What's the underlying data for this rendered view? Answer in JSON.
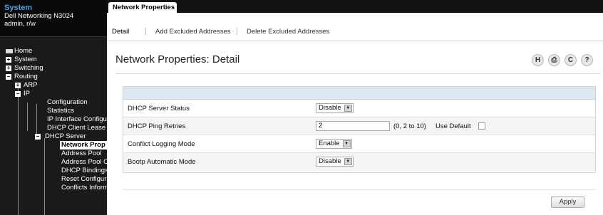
{
  "sidebar": {
    "title": "System",
    "device": "Dell Networking N3024",
    "user": "admin, r/w",
    "tree": {
      "home": "Home",
      "system": "System",
      "switching": "Switching",
      "routing": "Routing",
      "arp": "ARP",
      "ip": "IP",
      "configuration": "Configuration",
      "statistics": "Statistics",
      "ip_interface": "IP Interface Configu",
      "dhcp_client": "DHCP Client Lease",
      "dhcp_server": "DHCP Server",
      "network_props": "Network Prop",
      "address_pool": "Address Pool",
      "address_pool_opts": "Address Pool O",
      "dhcp_bindings": "DHCP Bindings",
      "reset_config": "Reset Configur",
      "conflicts_info": "Conflicts Inform"
    },
    "expander_plus": "+",
    "expander_minus": "−"
  },
  "header": {
    "tab": "Network Properties",
    "subtabs": [
      "Detail",
      "Add Excluded Addresses",
      "Delete Excluded Addresses"
    ]
  },
  "page": {
    "title": "Network Properties: Detail"
  },
  "tools": {
    "save_glyph": "H",
    "print_glyph": "⎙",
    "refresh_glyph": "C",
    "help_glyph": "?"
  },
  "form": {
    "server_status": {
      "label": "DHCP Server Status",
      "value": "Disable"
    },
    "ping_retries": {
      "label": "DHCP Ping Retries",
      "value": "2",
      "range": "(0, 2 to 10)",
      "use_default_label": "Use Default"
    },
    "conflict_logging": {
      "label": "Conflict Logging Mode",
      "value": "Enable"
    },
    "bootp_mode": {
      "label": "Bootp Automatic Mode",
      "value": "Disable"
    },
    "arrow_glyph": "▼"
  },
  "actions": {
    "apply": "Apply"
  },
  "colors": {
    "sidebar_bg": "#1a1a1a",
    "title_blue": "#4aa3e0",
    "panel_head": "#dde7f1"
  }
}
